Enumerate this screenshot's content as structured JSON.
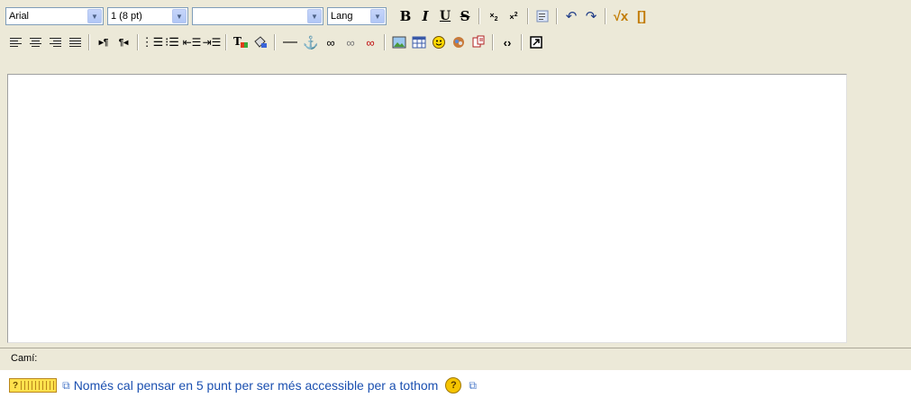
{
  "toolbar": {
    "font_family": "Arial",
    "font_size": "1 (8 pt)",
    "heading": "",
    "lang": "Lang",
    "bold": "B",
    "italic": "I",
    "underline": "U",
    "strike": "S"
  },
  "path_label": "Camí:",
  "footer": {
    "keyboard_label": "?",
    "link_text": "Només cal pensar en 5 punt per ser més accessible per a tothom",
    "help_label": "?"
  },
  "colors": {
    "toolbar_bg": "#ece9d8",
    "link": "#1a4fb0"
  }
}
